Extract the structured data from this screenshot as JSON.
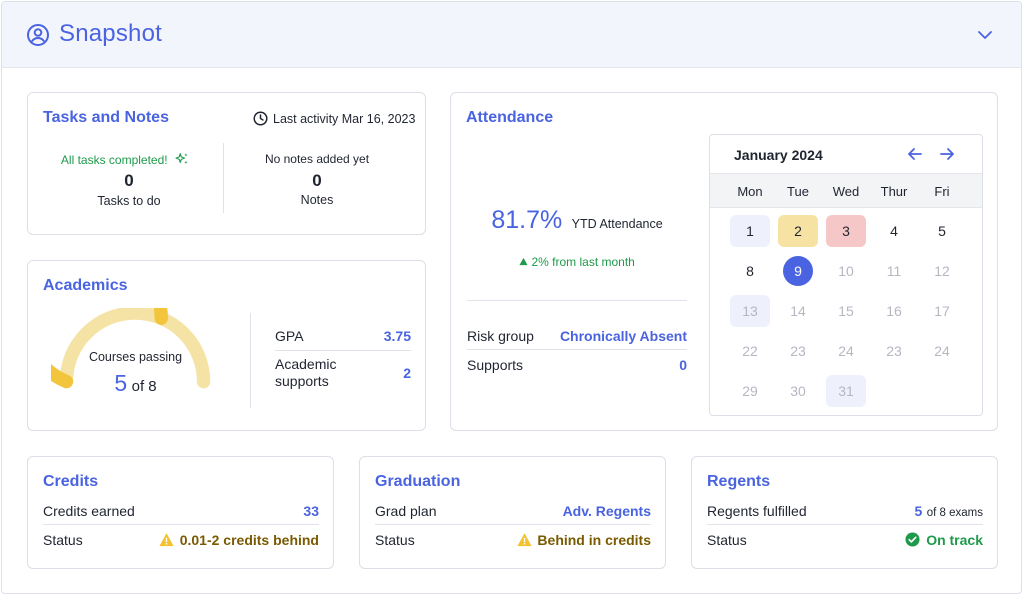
{
  "header": {
    "title": "Snapshot"
  },
  "tasks": {
    "title": "Tasks and Notes",
    "last_activity": "Last activity Mar 16, 2023",
    "completed_text": "All tasks completed!",
    "tasks_count": "0",
    "tasks_label": "Tasks to do",
    "no_notes_text": "No notes added yet",
    "notes_count": "0",
    "notes_label": "Notes"
  },
  "academics": {
    "title": "Academics",
    "gauge_label": "Courses passing",
    "gauge_value": "5",
    "gauge_total": "of 8",
    "gauge_fraction": 0.625,
    "gpa_label": "GPA",
    "gpa_value": "3.75",
    "supports_label": "Academic supports",
    "supports_value": "2"
  },
  "attendance": {
    "title": "Attendance",
    "percent": "81.7%",
    "percent_label": "YTD Attendance",
    "change": "2% from last month",
    "risk_label": "Risk group",
    "risk_value": "Chronically Absent",
    "supports_label": "Supports",
    "supports_value": "0",
    "calendar": {
      "month": "January 2024",
      "weekdays": [
        "Mon",
        "Tue",
        "Wed",
        "Thur",
        "Fri"
      ],
      "weeks": [
        [
          {
            "d": "1",
            "s": "light"
          },
          {
            "d": "2",
            "s": "yellow"
          },
          {
            "d": "3",
            "s": "red"
          },
          {
            "d": "4",
            "s": ""
          },
          {
            "d": "5",
            "s": ""
          }
        ],
        [
          {
            "d": "8",
            "s": ""
          },
          {
            "d": "9",
            "s": "today"
          },
          {
            "d": "10",
            "s": "muted"
          },
          {
            "d": "11",
            "s": "muted"
          },
          {
            "d": "12",
            "s": "muted"
          }
        ],
        [
          {
            "d": "13",
            "s": "light-muted"
          },
          {
            "d": "14",
            "s": "muted"
          },
          {
            "d": "15",
            "s": "muted"
          },
          {
            "d": "16",
            "s": "muted"
          },
          {
            "d": "17",
            "s": "muted"
          }
        ],
        [
          {
            "d": "22",
            "s": "muted"
          },
          {
            "d": "23",
            "s": "muted"
          },
          {
            "d": "24",
            "s": "muted"
          },
          {
            "d": "23",
            "s": "muted"
          },
          {
            "d": "24",
            "s": "muted"
          }
        ],
        [
          {
            "d": "29",
            "s": "muted"
          },
          {
            "d": "30",
            "s": "muted"
          },
          {
            "d": "31",
            "s": "light-muted"
          },
          {
            "d": "",
            "s": ""
          },
          {
            "d": "",
            "s": ""
          }
        ]
      ]
    }
  },
  "credits": {
    "title": "Credits",
    "earned_label": "Credits earned",
    "earned_value": "33",
    "status_label": "Status",
    "status_value": "0.01-2 credits behind"
  },
  "graduation": {
    "title": "Graduation",
    "plan_label": "Grad plan",
    "plan_value": "Adv. Regents",
    "status_label": "Status",
    "status_value": "Behind in credits"
  },
  "regents": {
    "title": "Regents",
    "fulfilled_label": "Regents fulfilled",
    "fulfilled_value": "5",
    "fulfilled_total": "of 8 exams",
    "status_label": "Status",
    "status_value": "On track"
  },
  "colors": {
    "accent": "#4a63e0",
    "success": "#1e9a4a",
    "warning_text": "#7a5a00",
    "warning_icon": "#f2c230",
    "gauge_fill": "#f2c53d",
    "gauge_track": "#f5e3a6",
    "cal_yellow": "#f6e3a3",
    "cal_red": "#f6c7c7",
    "cal_light": "#eef0fb"
  }
}
